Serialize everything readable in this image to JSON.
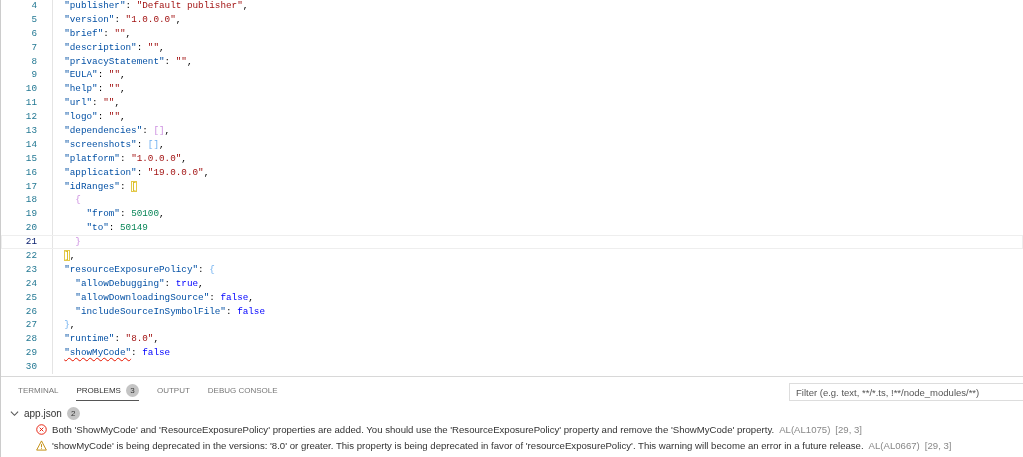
{
  "editor": {
    "lines": [
      {
        "number": "4",
        "current": false,
        "tokens": [
          {
            "kind": "key",
            "text": "\"publisher\""
          },
          {
            "kind": "punct",
            "text": ": "
          },
          {
            "kind": "str",
            "text": "\"Default publisher\""
          },
          {
            "kind": "punct",
            "text": ","
          }
        ]
      },
      {
        "number": "5",
        "current": false,
        "tokens": [
          {
            "kind": "key",
            "text": "\"version\""
          },
          {
            "kind": "punct",
            "text": ": "
          },
          {
            "kind": "str",
            "text": "\"1.0.0.0\""
          },
          {
            "kind": "punct",
            "text": ","
          }
        ]
      },
      {
        "number": "6",
        "current": false,
        "tokens": [
          {
            "kind": "key",
            "text": "\"brief\""
          },
          {
            "kind": "punct",
            "text": ": "
          },
          {
            "kind": "str",
            "text": "\"\""
          },
          {
            "kind": "punct",
            "text": ","
          }
        ]
      },
      {
        "number": "7",
        "current": false,
        "tokens": [
          {
            "kind": "key",
            "text": "\"description\""
          },
          {
            "kind": "punct",
            "text": ": "
          },
          {
            "kind": "str",
            "text": "\"\""
          },
          {
            "kind": "punct",
            "text": ","
          }
        ]
      },
      {
        "number": "8",
        "current": false,
        "tokens": [
          {
            "kind": "key",
            "text": "\"privacyStatement\""
          },
          {
            "kind": "punct",
            "text": ": "
          },
          {
            "kind": "str",
            "text": "\"\""
          },
          {
            "kind": "punct",
            "text": ","
          }
        ]
      },
      {
        "number": "9",
        "current": false,
        "tokens": [
          {
            "kind": "key",
            "text": "\"EULA\""
          },
          {
            "kind": "punct",
            "text": ": "
          },
          {
            "kind": "str",
            "text": "\"\""
          },
          {
            "kind": "punct",
            "text": ","
          }
        ]
      },
      {
        "number": "10",
        "current": false,
        "tokens": [
          {
            "kind": "key",
            "text": "\"help\""
          },
          {
            "kind": "punct",
            "text": ": "
          },
          {
            "kind": "str",
            "text": "\"\""
          },
          {
            "kind": "punct",
            "text": ","
          }
        ]
      },
      {
        "number": "11",
        "current": false,
        "tokens": [
          {
            "kind": "key",
            "text": "\"url\""
          },
          {
            "kind": "punct",
            "text": ": "
          },
          {
            "kind": "str",
            "text": "\"\""
          },
          {
            "kind": "punct",
            "text": ","
          }
        ]
      },
      {
        "number": "12",
        "current": false,
        "tokens": [
          {
            "kind": "key",
            "text": "\"logo\""
          },
          {
            "kind": "punct",
            "text": ": "
          },
          {
            "kind": "str",
            "text": "\"\""
          },
          {
            "kind": "punct",
            "text": ","
          }
        ]
      },
      {
        "number": "13",
        "current": false,
        "tokens": [
          {
            "kind": "key",
            "text": "\"dependencies\""
          },
          {
            "kind": "punct",
            "text": ": "
          },
          {
            "kind": "bracket2",
            "text": "[]"
          },
          {
            "kind": "punct",
            "text": ","
          }
        ]
      },
      {
        "number": "14",
        "current": false,
        "tokens": [
          {
            "kind": "key",
            "text": "\"screenshots\""
          },
          {
            "kind": "punct",
            "text": ": "
          },
          {
            "kind": "bracket3",
            "text": "[]"
          },
          {
            "kind": "punct",
            "text": ","
          }
        ]
      },
      {
        "number": "15",
        "current": false,
        "tokens": [
          {
            "kind": "key",
            "text": "\"platform\""
          },
          {
            "kind": "punct",
            "text": ": "
          },
          {
            "kind": "str",
            "text": "\"1.0.0.0\""
          },
          {
            "kind": "punct",
            "text": ","
          }
        ]
      },
      {
        "number": "16",
        "current": false,
        "tokens": [
          {
            "kind": "key",
            "text": "\"application\""
          },
          {
            "kind": "punct",
            "text": ": "
          },
          {
            "kind": "str",
            "text": "\"19.0.0.0\""
          },
          {
            "kind": "punct",
            "text": ","
          }
        ]
      },
      {
        "number": "17",
        "current": false,
        "tokens": [
          {
            "kind": "key",
            "text": "\"idRanges\""
          },
          {
            "kind": "punct",
            "text": ": "
          },
          {
            "kind": "bracket1",
            "text": "[",
            "matched": true
          }
        ]
      },
      {
        "number": "18",
        "current": false,
        "tokens": [
          {
            "kind": "bracket2",
            "text": "{"
          }
        ]
      },
      {
        "number": "19",
        "current": false,
        "tokens": [
          {
            "kind": "key",
            "text": "\"from\""
          },
          {
            "kind": "punct",
            "text": ": "
          },
          {
            "kind": "num",
            "text": "50100"
          },
          {
            "kind": "punct",
            "text": ","
          }
        ]
      },
      {
        "number": "20",
        "current": false,
        "tokens": [
          {
            "kind": "key",
            "text": "\"to\""
          },
          {
            "kind": "punct",
            "text": ": "
          },
          {
            "kind": "num",
            "text": "50149"
          }
        ]
      },
      {
        "number": "21",
        "current": true,
        "tokens": [
          {
            "kind": "bracket2",
            "text": "}"
          }
        ]
      },
      {
        "number": "22",
        "current": false,
        "tokens": [
          {
            "kind": "bracket1",
            "text": "]",
            "matched": true
          },
          {
            "kind": "punct",
            "text": ","
          }
        ]
      },
      {
        "number": "23",
        "current": false,
        "tokens": [
          {
            "kind": "key",
            "text": "\"resourceExposurePolicy\""
          },
          {
            "kind": "punct",
            "text": ": "
          },
          {
            "kind": "bracket3",
            "text": "{"
          }
        ]
      },
      {
        "number": "24",
        "current": false,
        "tokens": [
          {
            "kind": "key",
            "text": "\"allowDebugging\""
          },
          {
            "kind": "punct",
            "text": ": "
          },
          {
            "kind": "kw",
            "text": "true"
          },
          {
            "kind": "punct",
            "text": ","
          }
        ]
      },
      {
        "number": "25",
        "current": false,
        "tokens": [
          {
            "kind": "key",
            "text": "\"allowDownloadingSource\""
          },
          {
            "kind": "punct",
            "text": ": "
          },
          {
            "kind": "kw",
            "text": "false"
          },
          {
            "kind": "punct",
            "text": ","
          }
        ]
      },
      {
        "number": "26",
        "current": false,
        "tokens": [
          {
            "kind": "key",
            "text": "\"includeSourceInSymbolFile\""
          },
          {
            "kind": "punct",
            "text": ": "
          },
          {
            "kind": "kw",
            "text": "false"
          }
        ]
      },
      {
        "number": "27",
        "current": false,
        "tokens": [
          {
            "kind": "bracket3",
            "text": "}"
          },
          {
            "kind": "punct",
            "text": ","
          }
        ]
      },
      {
        "number": "28",
        "current": false,
        "tokens": [
          {
            "kind": "key",
            "text": "\"runtime\""
          },
          {
            "kind": "punct",
            "text": ": "
          },
          {
            "kind": "str",
            "text": "\"8.0\""
          },
          {
            "kind": "punct",
            "text": ","
          }
        ]
      },
      {
        "number": "29",
        "current": false,
        "tokens": [
          {
            "kind": "key",
            "text": "\"showMyCode\"",
            "error": true
          },
          {
            "kind": "punct",
            "text": ": "
          },
          {
            "kind": "kw",
            "text": "false"
          }
        ]
      },
      {
        "number": "30",
        "current": false
      }
    ]
  },
  "panel": {
    "tabs": [
      {
        "label": "TERMINAL",
        "selected": false
      },
      {
        "label": "PROBLEMS",
        "selected": true,
        "badge": "3"
      },
      {
        "label": "OUTPUT",
        "selected": false
      },
      {
        "label": "DEBUG CONSOLE",
        "selected": false
      }
    ],
    "filter": {
      "placeholder": "Filter (e.g. text, **/*.ts, !**/node_modules/**)"
    },
    "files": [
      {
        "name": "app.json",
        "count": "2",
        "expanded": true,
        "problems": [
          {
            "kind": "error",
            "message": "Both 'ShowMyCode' and 'ResourceExposurePolicy' properties are added. You should use the 'ResourceExposurePolicy' property and remove the 'ShowMyCode' property.",
            "code": "AL(AL1075)",
            "position": "[29, 3]"
          },
          {
            "kind": "warning",
            "message": "'showMyCode' is being deprecated in the versions: '8.0' or greater. This property is being deprecated in favor of 'resourceExposurePolicy'. This warning will become an error in a future release.",
            "code": "AL(AL0667)",
            "position": "[29, 3]"
          }
        ]
      }
    ]
  }
}
